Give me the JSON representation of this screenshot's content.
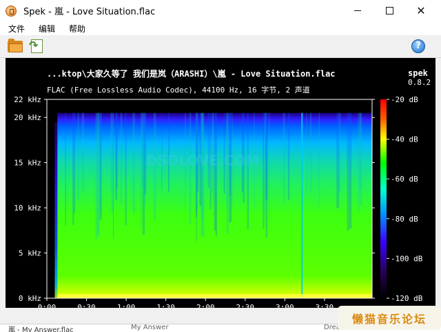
{
  "window": {
    "title": "Spek - 嵐 - Love Situation.flac",
    "minimize_glyph": "minimize-icon",
    "maximize_glyph": "maximize-icon",
    "close_label": "✕"
  },
  "menu": [
    "文件",
    "编辑",
    "帮助"
  ],
  "toolbar": {
    "open_icon": "folder-open-icon",
    "save_icon": "save-image-icon",
    "help_label": "?"
  },
  "spectrum": {
    "file_path": "...ktop\\大家久等了 我们是岚（ARASHI）\\嵐 - Love Situation.flac",
    "app_name": "spek",
    "version": "0.8.2",
    "file_info": "FLAC (Free Lossless Audio Codec), 44100 Hz, 16 字节, 2 声道",
    "watermark": "DSDLOVE.COM"
  },
  "chart_data": {
    "type": "heatmap",
    "title": "...ktop\\大家久等了 我们是岚（ARASHI）\\嵐 - Love Situation.flac",
    "subtitle": "FLAC (Free Lossless Audio Codec), 44100 Hz, 16 字节, 2 声道",
    "x_axis": {
      "range_seconds": [
        0,
        246
      ],
      "tick_labels": [
        "0:00",
        "0:30",
        "1:00",
        "1:30",
        "2:00",
        "2:30",
        "3:00",
        "3:30"
      ],
      "tick_values": [
        0,
        30,
        60,
        90,
        120,
        150,
        180,
        210
      ]
    },
    "y_axis": {
      "range_khz": [
        0,
        22
      ],
      "tick_labels": [
        "0 kHz",
        "5 kHz",
        "10 kHz",
        "15 kHz",
        "20 kHz",
        "22 kHz"
      ],
      "tick_values": [
        0,
        5,
        10,
        15,
        20,
        22
      ]
    },
    "color_scale": {
      "range_db": [
        -120,
        -20
      ],
      "tick_labels": [
        "-20 dB",
        "-40 dB",
        "-60 dB",
        "-80 dB",
        "-100 dB",
        "-120 dB"
      ],
      "tick_values": [
        -20,
        -40,
        -60,
        -80,
        -100,
        -120
      ],
      "colors": [
        "#000000",
        "#2a0060",
        "#3c00ff",
        "#0090ff",
        "#00ffd0",
        "#00ff00",
        "#ffff00",
        "#ff6000",
        "#ff0000"
      ]
    },
    "notes": {
      "audio_start_seconds": 8,
      "cutoff_khz": 20.5,
      "vertical_line_seconds": 193
    }
  },
  "taskbar": {
    "item_a": "嵐 - My Answer.flac",
    "item_b": "My Answer",
    "item_c": "Dream"
  },
  "badge": {
    "text": "懒猫音乐论坛"
  }
}
